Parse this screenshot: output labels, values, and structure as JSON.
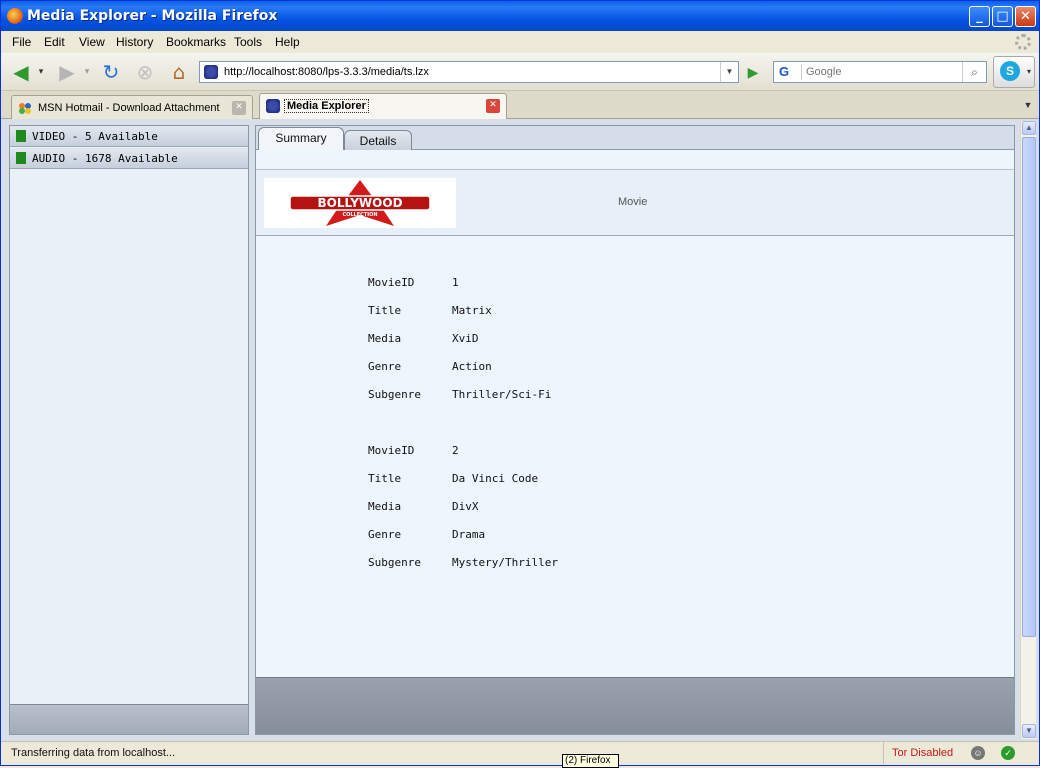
{
  "window": {
    "title": "Media Explorer - Mozilla Firefox",
    "minimize": "_",
    "maximize": "□",
    "close": "✕"
  },
  "menu": [
    "File",
    "Edit",
    "View",
    "History",
    "Bookmarks",
    "Tools",
    "Help"
  ],
  "nav": {
    "url": "http://localhost:8080/lps-3.3.3/media/ts.lzx",
    "search_engine": "G",
    "search_placeholder": "Google"
  },
  "tabs": [
    {
      "label": "MSN Hotmail - Download Attachment",
      "active": false
    },
    {
      "label": "Media Explorer",
      "active": true
    }
  ],
  "categories": [
    {
      "label": "VIDEO - 5 Available",
      "color": "#1e8a1e"
    },
    {
      "label": "AUDIO - 1678 Available",
      "color": "#1e8a1e"
    }
  ],
  "app_tabs": [
    {
      "label": "Summary",
      "active": true
    },
    {
      "label": "Details",
      "active": false
    }
  ],
  "header": {
    "logo_text": "BOLLYWOOD",
    "logo_subtext": "COLLECTION",
    "type_label": "Movie"
  },
  "movies": [
    {
      "fields": [
        {
          "key": "MovieID",
          "value": "1"
        },
        {
          "key": "Title",
          "value": "Matrix"
        },
        {
          "key": "Media",
          "value": "XviD"
        },
        {
          "key": "Genre",
          "value": "Action"
        },
        {
          "key": "Subgenre",
          "value": "Thriller/Sci-Fi"
        }
      ]
    },
    {
      "fields": [
        {
          "key": "MovieID",
          "value": "2"
        },
        {
          "key": "Title",
          "value": "Da Vinci Code"
        },
        {
          "key": "Media",
          "value": "DivX"
        },
        {
          "key": "Genre",
          "value": "Drama"
        },
        {
          "key": "Subgenre",
          "value": "Mystery/Thriller"
        }
      ]
    }
  ],
  "status": {
    "text": "Transferring data from localhost...",
    "tor": "Tor Disabled",
    "tooltip": "(2) Firefox"
  }
}
